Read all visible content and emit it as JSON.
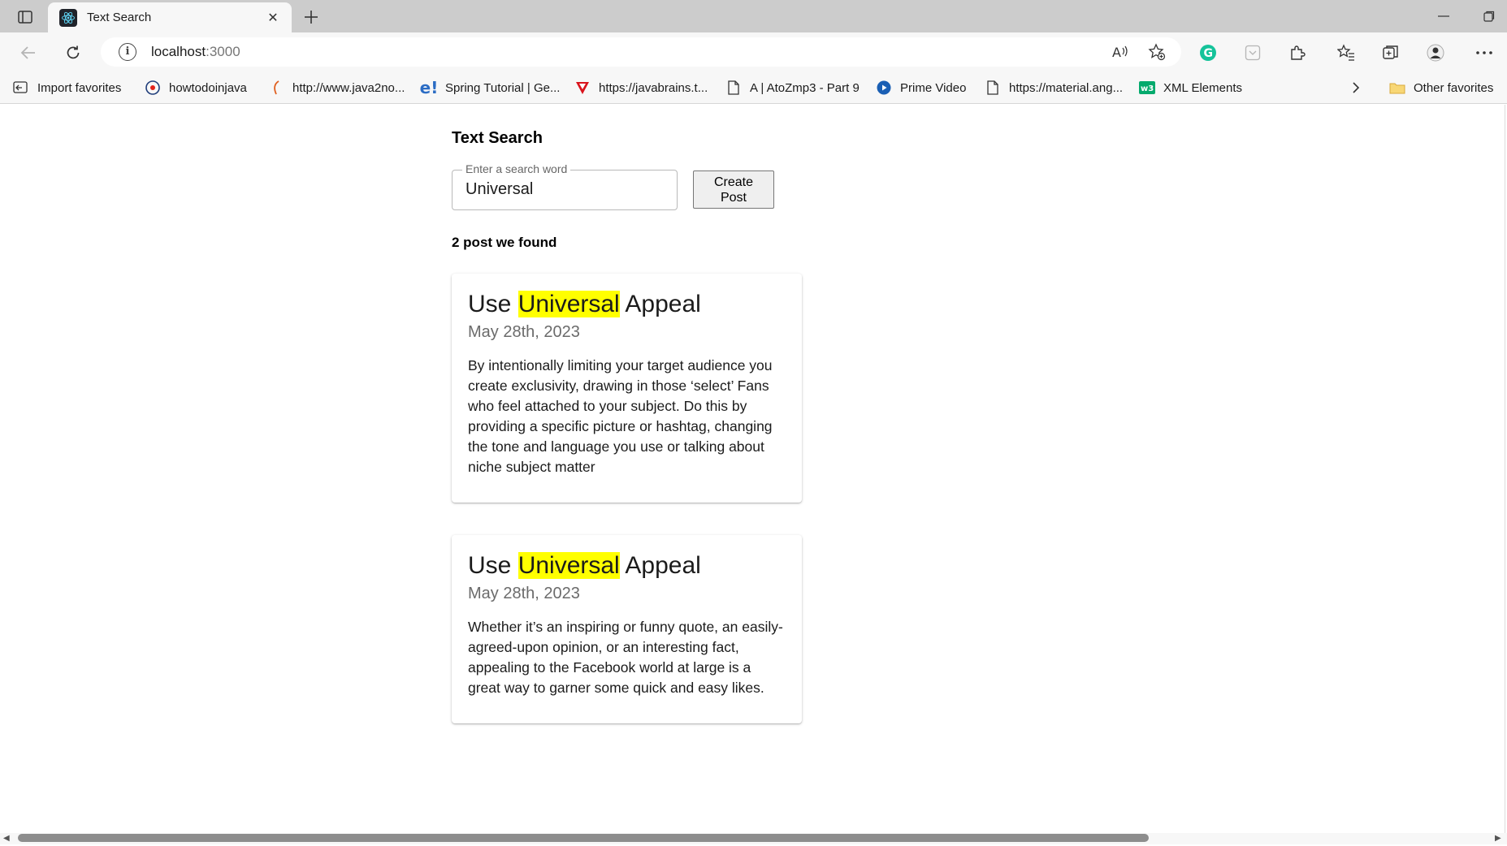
{
  "tab": {
    "title": "Text Search",
    "close": "✕"
  },
  "address": {
    "host": "localhost",
    "port": ":3000"
  },
  "favorites": [
    {
      "label": "Import favorites",
      "icon": "import-icon"
    },
    {
      "label": "howtodoinjava",
      "icon": "howtodoinjava-icon"
    },
    {
      "label": "http://www.java2no...",
      "icon": "java2novice-icon"
    },
    {
      "label": "Spring Tutorial | Ge...",
      "icon": "edge-e-icon"
    },
    {
      "label": "https://javabrains.t...",
      "icon": "javabrains-icon"
    },
    {
      "label": "A | AtoZmp3 - Part 9",
      "icon": "page-icon"
    },
    {
      "label": "Prime Video",
      "icon": "prime-video-icon"
    },
    {
      "label": "https://material.ang...",
      "icon": "page-icon"
    },
    {
      "label": "XML Elements",
      "icon": "w3schools-icon"
    }
  ],
  "other_favorites": "Other favorites",
  "page": {
    "title": "Text Search",
    "search": {
      "label": "Enter a search word",
      "value": "Universal"
    },
    "create_button": {
      "line1": "Create",
      "line2": "Post"
    },
    "result_count": "2 post we found",
    "posts": [
      {
        "title_before": "Use ",
        "title_highlight": "Universal",
        "title_after": " Appeal",
        "date": "May 28th, 2023",
        "body": "By intentionally limiting your target audience you create exclusivity, drawing in those ‘select’ Fans who feel attached to your subject. Do this by providing a specific picture or hashtag, changing the tone and language you use or talking about niche subject matter"
      },
      {
        "title_before": "Use ",
        "title_highlight": "Universal",
        "title_after": " Appeal",
        "date": "May 28th, 2023",
        "body": "Whether it’s an inspiring or funny quote, an easily-agreed-upon opinion, or an interesting fact, appealing to the Facebook world at large is a great way to garner some quick and easy likes."
      }
    ]
  },
  "colors": {
    "highlight": "#ffff00",
    "grammarly": "#15c39a",
    "react": "#61dafb"
  }
}
